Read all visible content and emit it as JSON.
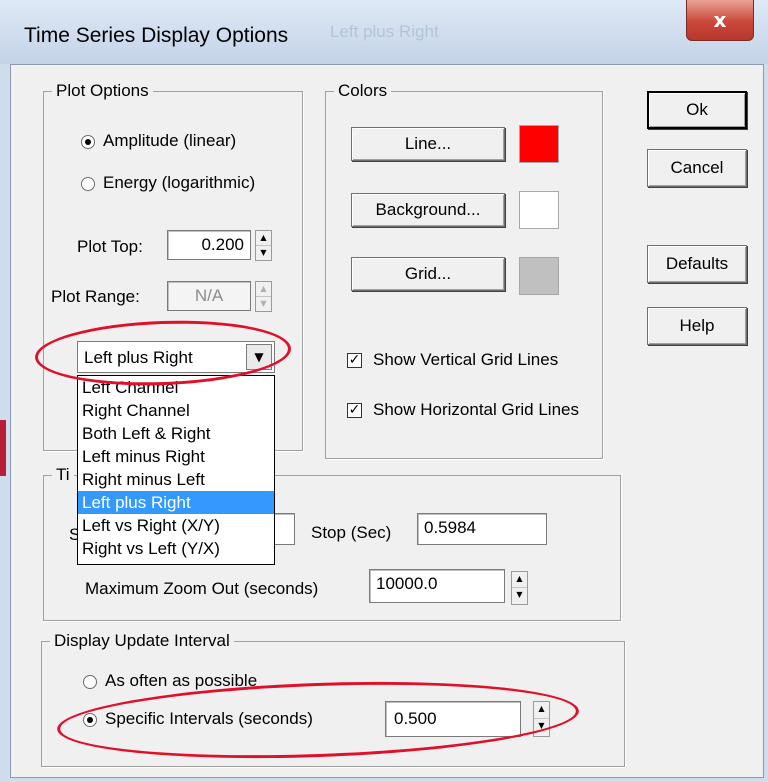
{
  "window": {
    "title": "Time Series Display Options",
    "ghost_text": "Left plus Right",
    "close_label": "x"
  },
  "plot_options": {
    "legend": "Plot Options",
    "amplitude_label": "Amplitude (linear)",
    "energy_label": "Energy (logarithmic)",
    "selected": "Amplitude (linear)",
    "plot_top_label": "Plot Top:",
    "plot_top_value": "0.200",
    "plot_range_label": "Plot Range:",
    "plot_range_value": "N/A",
    "channel_value": "Left plus Right",
    "channel_options": [
      "Left Channel",
      "Right Channel",
      "Both Left & Right",
      "Left minus Right",
      "Right minus Left",
      "Left plus Right",
      "Left vs Right (X/Y)",
      "Right vs Left (Y/X)"
    ],
    "dropdown_arrow": "▼"
  },
  "colors": {
    "legend": "Colors",
    "line_button": "Line...",
    "background_button": "Background...",
    "grid_button": "Grid...",
    "line_color": "#ff0000",
    "background_color": "#ffffff",
    "grid_color": "#c0c0c0",
    "show_vertical_label": "Show Vertical Grid Lines",
    "show_vertical_checked": true,
    "show_horizontal_label": "Show Horizontal Grid Lines",
    "show_horizontal_checked": true,
    "check_mark": "✓"
  },
  "time_group": {
    "legend_partial": "Ti",
    "start_partial": "S",
    "stop_label": "Stop (Sec)",
    "stop_value": "0.5984",
    "max_zoom_label": "Maximum Zoom Out (seconds)",
    "max_zoom_value": "10000.0"
  },
  "update_interval": {
    "legend": "Display Update Interval",
    "as_often_label": "As often as possible",
    "specific_label": "Specific Intervals (seconds)",
    "selected": "Specific Intervals (seconds)",
    "interval_value": "0.500"
  },
  "buttons": {
    "ok": "Ok",
    "cancel": "Cancel",
    "defaults": "Defaults",
    "help": "Help"
  },
  "spin_glyphs": {
    "up": "▲",
    "down": "▼"
  },
  "annotation_color": "#e0102a"
}
